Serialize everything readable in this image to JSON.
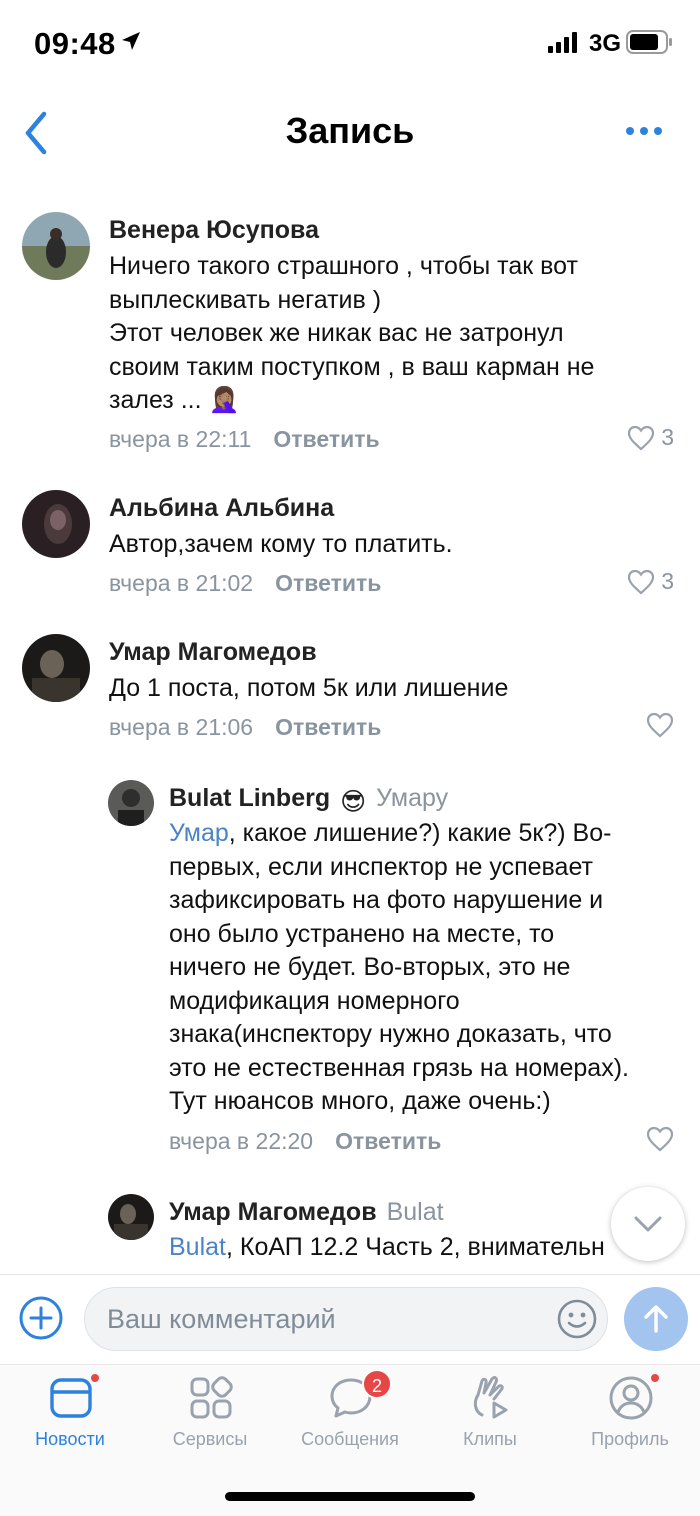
{
  "status_bar": {
    "time": "09:48",
    "network": "3G"
  },
  "nav": {
    "title": "Запись"
  },
  "comments": [
    {
      "author": "Венера Юсупова",
      "text_lines": [
        "Ничего такого страшного , чтобы так вот",
        "выплескивать негатив )",
        "Этот человек же никак вас не затронул",
        "своим таким поступком , в ваш карман не",
        "залез ... 🤦🏽‍♀️"
      ],
      "time": "вчера в 22:11",
      "reply_label": "Ответить",
      "likes": "3"
    },
    {
      "author": "Альбина Альбина",
      "text_lines": [
        "Автор,зачем кому то платить."
      ],
      "time": "вчера в 21:02",
      "reply_label": "Ответить",
      "likes": "3"
    },
    {
      "author": "Умар Магомедов",
      "text_lines": [
        "До 1 поста, потом 5к или лишение"
      ],
      "time": "вчера в 21:06",
      "reply_label": "Ответить",
      "likes": ""
    }
  ],
  "replies": [
    {
      "author": "Bulat Linberg",
      "author_emoji": "😎",
      "reply_to": "Умару",
      "mention": "Умар",
      "text_first": ", какое лишение?) какие 5к?) Во-",
      "text_lines": [
        "первых, если инспектор не успевает",
        "зафиксировать на фото нарушение и",
        "оно было устранено на месте, то",
        "ничего не будет. Во-вторых, это не",
        "модификация номерного",
        "знака(инспектору нужно доказать, что",
        "это не естественная грязь на номерах).",
        "Тут нюансов много, даже очень:)"
      ],
      "time": "вчера в 22:20",
      "reply_label": "Ответить"
    },
    {
      "author": "Умар Магомедов",
      "reply_to": "Bulat",
      "mention": "Bulat",
      "text_first": ", КоАП 12.2 Часть 2, внимательн"
    }
  ],
  "composer": {
    "placeholder": "Ваш комментарий"
  },
  "tabs": [
    {
      "label": "Новости",
      "active": true
    },
    {
      "label": "Сервисы"
    },
    {
      "label": "Сообщения",
      "badge": "2"
    },
    {
      "label": "Клипы"
    },
    {
      "label": "Профиль"
    }
  ],
  "colors": {
    "accent": "#2d81e0",
    "mention": "#4a83c6",
    "secondary": "#8a949f",
    "badge": "#e64646"
  }
}
